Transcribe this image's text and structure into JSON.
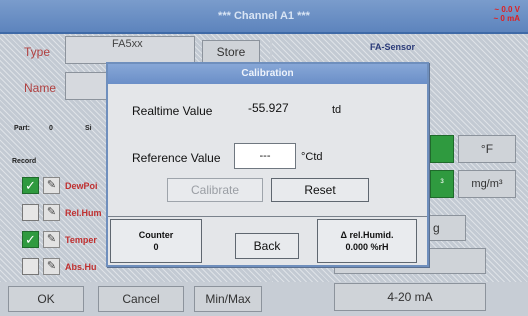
{
  "header": {
    "title": "*** Channel A1 ***",
    "status_line1": "~ 0.0 V",
    "status_line2": "~ 0 mA"
  },
  "left_panel": {
    "type_label": "Type",
    "type_value": "FA5xx",
    "store_label": "Store",
    "name_label": "Name",
    "part_label": "Part:",
    "part_value": "0",
    "part_extra": "Si",
    "record_label": "Record",
    "records": [
      {
        "label": "DewPoi",
        "checked": true
      },
      {
        "label": "Rel.Hum",
        "checked": false
      },
      {
        "label": "Temper",
        "checked": true
      },
      {
        "label": "Abs.Hu",
        "checked": false
      }
    ]
  },
  "right_panel": {
    "sensor_title": "FA-Sensor",
    "unit_f": "°F",
    "unit_m3": "³",
    "unit_mgm3": "mg/m³",
    "settings_fragment": "g",
    "analog_output": "4-20 mA"
  },
  "footer": {
    "ok": "OK",
    "cancel": "Cancel",
    "minmax": "Min/Max"
  },
  "dialog": {
    "title": "Calibration",
    "realtime_label": "Realtime Value",
    "realtime_value": "-55.927",
    "realtime_unit": "td",
    "reference_label": "Reference Value",
    "reference_value": "---",
    "reference_unit": "°Ctd",
    "calibrate": "Calibrate",
    "reset": "Reset",
    "counter_label": "Counter",
    "counter_value": "0",
    "back": "Back",
    "humid_label": "Δ rel.Humid.",
    "humid_value": "0.000 %rH"
  }
}
